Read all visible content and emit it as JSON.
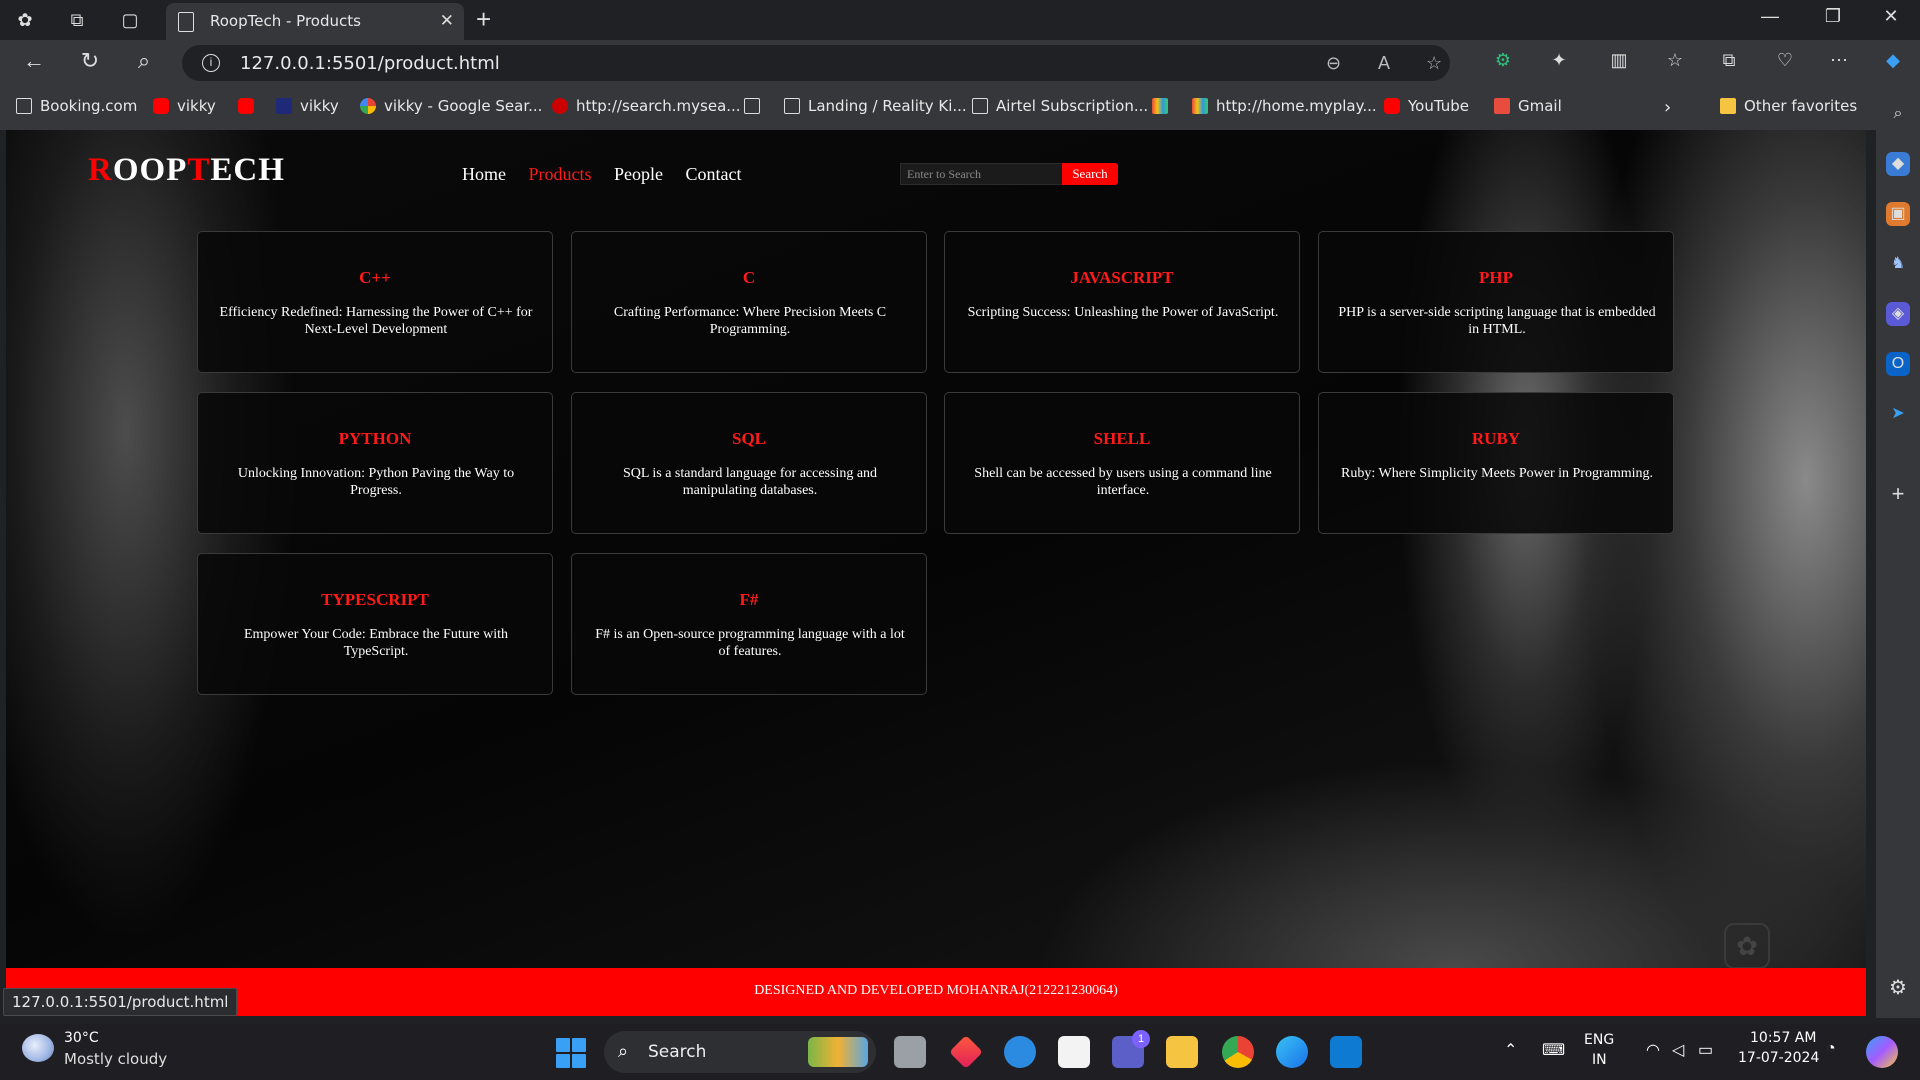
{
  "browser": {
    "tab_title": "RoopTech - Products",
    "url": "127.0.0.1:5501/product.html",
    "status_url": "127.0.0.1:5501/product.html",
    "bookmarks": [
      {
        "label": "Booking.com",
        "icon": "page-icon"
      },
      {
        "label": "vikky",
        "icon": "youtube-icon"
      },
      {
        "label": "",
        "icon": "youtube-icon"
      },
      {
        "label": "vikky",
        "icon": "shaadi-icon"
      },
      {
        "label": "vikky - Google Sear...",
        "icon": "google-icon"
      },
      {
        "label": "http://search.mysea...",
        "icon": "ask-icon"
      },
      {
        "label": "",
        "icon": "page-icon"
      },
      {
        "label": "Landing / Reality Ki...",
        "icon": "page-icon"
      },
      {
        "label": "Airtel Subscription...",
        "icon": "page-icon"
      },
      {
        "label": "",
        "icon": "multicolor-icon"
      },
      {
        "label": "http://home.myplay...",
        "icon": "multicolor-icon"
      },
      {
        "label": "YouTube",
        "icon": "youtube-icon"
      },
      {
        "label": "Gmail",
        "icon": "gmail-icon"
      }
    ],
    "other_favorites": "Other favorites"
  },
  "site": {
    "logo": {
      "part1": "R",
      "part2": "OOP",
      "part3": "T",
      "part4": "ECH"
    },
    "nav": [
      {
        "label": "Home",
        "active": false
      },
      {
        "label": "Products",
        "active": true
      },
      {
        "label": "People",
        "active": false
      },
      {
        "label": "Contact",
        "active": false
      }
    ],
    "search": {
      "placeholder": "Enter to Search",
      "button": "Search"
    },
    "products": [
      {
        "title": "C++",
        "desc": "Efficiency Redefined: Harnessing the Power of C++ for Next-Level Development"
      },
      {
        "title": "C",
        "desc": "Crafting Performance: Where Precision Meets C Programming."
      },
      {
        "title": "JAVASCRIPT",
        "desc": "Scripting Success: Unleashing the Power of JavaScript."
      },
      {
        "title": "PHP",
        "desc": "PHP is a server-side scripting language that is embedded in HTML."
      },
      {
        "title": "PYTHON",
        "desc": "Unlocking Innovation: Python Paving the Way to Progress."
      },
      {
        "title": "SQL",
        "desc": "SQL is a standard language for accessing and manipulating databases."
      },
      {
        "title": "SHELL",
        "desc": "Shell can be accessed by users using a command line interface."
      },
      {
        "title": "RUBY",
        "desc": "Ruby: Where Simplicity Meets Power in Programming."
      },
      {
        "title": "TYPESCRIPT",
        "desc": "Empower Your Code: Embrace the Future with TypeScript."
      },
      {
        "title": "F#",
        "desc": "F# is an Open-source programming language with a lot of features."
      }
    ],
    "footer": "DESIGNED AND DEVELOPED MOHANRAJ(212221230064)"
  },
  "taskbar": {
    "weather_temp": "30°C",
    "weather_desc": "Mostly cloudy",
    "search_label": "Search",
    "lang_line1": "ENG",
    "lang_line2": "IN",
    "time": "10:57 AM",
    "date": "17-07-2024",
    "teams_badge": "1"
  },
  "colors": {
    "accent": "#ff0000",
    "background": "#000000"
  }
}
